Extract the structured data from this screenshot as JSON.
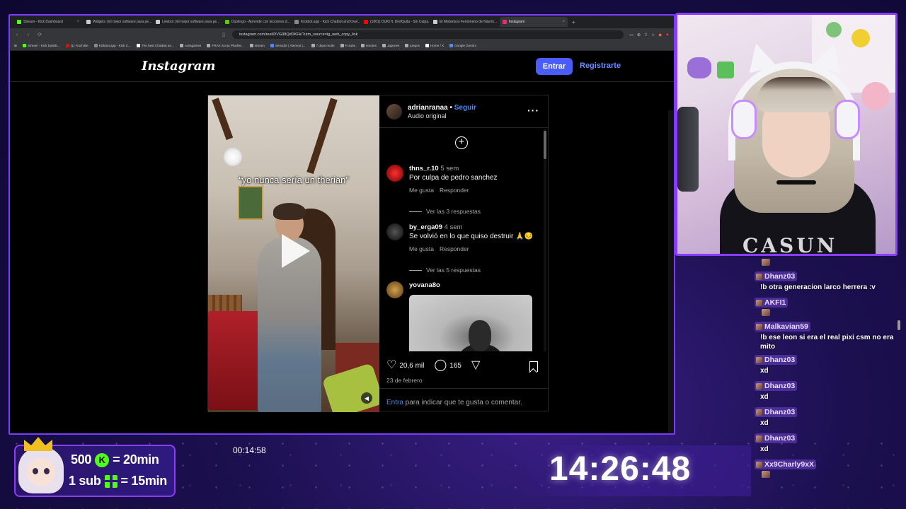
{
  "browser": {
    "tabs": [
      {
        "label": "Stream - Kick Dashboard",
        "color": "#53fc18"
      },
      {
        "label": "Widgets | El mejor software para pe...",
        "color": "#cccccc"
      },
      {
        "label": "Livebot | El mejor software para pe...",
        "color": "#cccccc"
      },
      {
        "label": "Duolingo - Aprende con lecciones d...",
        "color": "#58cc02"
      },
      {
        "label": "Kickbot.app - Kick Chatbot and Over...",
        "color": "#888888"
      },
      {
        "label": "(1001) DUKI ft. DrefQuila - Sin Culpa...",
        "color": "#ff0000"
      },
      {
        "label": "El Misterioso Fenómeno de Násrm...",
        "color": "#cccccc"
      },
      {
        "label": "Instagram",
        "color": "#e1306c"
      }
    ],
    "url": "instagram.com/reel/DVG98QdDKFk/?utm_source=ig_web_copy_link",
    "bookmarks": [
      {
        "label": "Stream - Kick Dashb...",
        "color": "#53fc18"
      },
      {
        "label": "(1) YouTube",
        "color": "#ff0000"
      },
      {
        "label": "Kickbot.app - Kick C...",
        "color": "#888888"
      },
      {
        "label": "The best ChatBot an...",
        "color": "#ffffff"
      },
      {
        "label": "Lessgames",
        "color": "#aaaaaa"
      },
      {
        "label": "FRAK Scout Plushie...",
        "color": "#aaaaaa"
      },
      {
        "label": "stream",
        "color": "#aaaaaa"
      },
      {
        "label": "Servidor | Aternos |...",
        "color": "#4a8cff"
      },
      {
        "label": "7 days mods",
        "color": "#aaaaaa"
      },
      {
        "label": "R subs",
        "color": "#aaaaaa"
      },
      {
        "label": "emotes",
        "color": "#aaaaaa"
      },
      {
        "label": "Japones",
        "color": "#aaaaaa"
      },
      {
        "label": "juegos",
        "color": "#aaaaaa"
      },
      {
        "label": "Home / X",
        "color": "#ffffff"
      },
      {
        "label": "Google Gemini",
        "color": "#4a8cff"
      }
    ]
  },
  "instagram": {
    "logo": "Instagram",
    "login_button": "Entrar",
    "signup_link": "Registrarte",
    "video_caption": "“yo nunca sería un therian”",
    "author": "adrianranaa",
    "follow": "Seguir",
    "audio": "Audio original",
    "comments": [
      {
        "user": "thns_r.10",
        "time": "5 sem",
        "text": "Por culpa de pedro sanchez",
        "like": "Me gusta",
        "reply": "Responder",
        "replies": "Ver las 3 respuestas",
        "avatar_color": "#c01010"
      },
      {
        "user": "by_erga09",
        "time": "4 sem",
        "text": "Se volvió en lo que quiso destruir 🙏😔",
        "like": "Me gusta",
        "reply": "Responder",
        "replies": "Ver las 5 respuestas",
        "avatar_color": "#1a1a1a"
      },
      {
        "user": "yovana8o",
        "time": "",
        "text": "",
        "avatar_color": "#8a6030"
      }
    ],
    "likes": "20,6 mil",
    "comments_count": "165",
    "date": "23 de febrero",
    "login_link": "Entra",
    "login_prompt_rest": " para indicar que te gusta o comentar."
  },
  "chat": [
    {
      "type": "emote"
    },
    {
      "type": "user",
      "name": "Dhanz03"
    },
    {
      "type": "msg",
      "text": "!b otra generacion larco herrera :v"
    },
    {
      "type": "user",
      "name": "AKFI1"
    },
    {
      "type": "emote"
    },
    {
      "type": "user",
      "name": "Malkavian59"
    },
    {
      "type": "msg",
      "text": "!b ese leon si era el real pixi csm no era mito"
    },
    {
      "type": "user",
      "name": "Dhanz03"
    },
    {
      "type": "msg",
      "text": "xd"
    },
    {
      "type": "user",
      "name": "Dhanz03"
    },
    {
      "type": "msg",
      "text": "xd"
    },
    {
      "type": "user",
      "name": "Dhanz03"
    },
    {
      "type": "msg",
      "text": "xd"
    },
    {
      "type": "user",
      "name": "Dhanz03"
    },
    {
      "type": "msg",
      "text": "xd"
    },
    {
      "type": "user",
      "name": "Xx9Charly9xX"
    },
    {
      "type": "emote"
    }
  ],
  "overlay": {
    "goal_line1_amount": "500",
    "goal_line1_icon": "K",
    "goal_line1_value": "= 20min",
    "goal_line2_amount": "1 sub",
    "goal_line2_value": "= 15min",
    "uptime": "00:14:58",
    "clock": "14:26:48",
    "accent": "#8a3cff",
    "kick_green": "#53fc18"
  },
  "webcam": {
    "shirt_text": "CASUN"
  }
}
